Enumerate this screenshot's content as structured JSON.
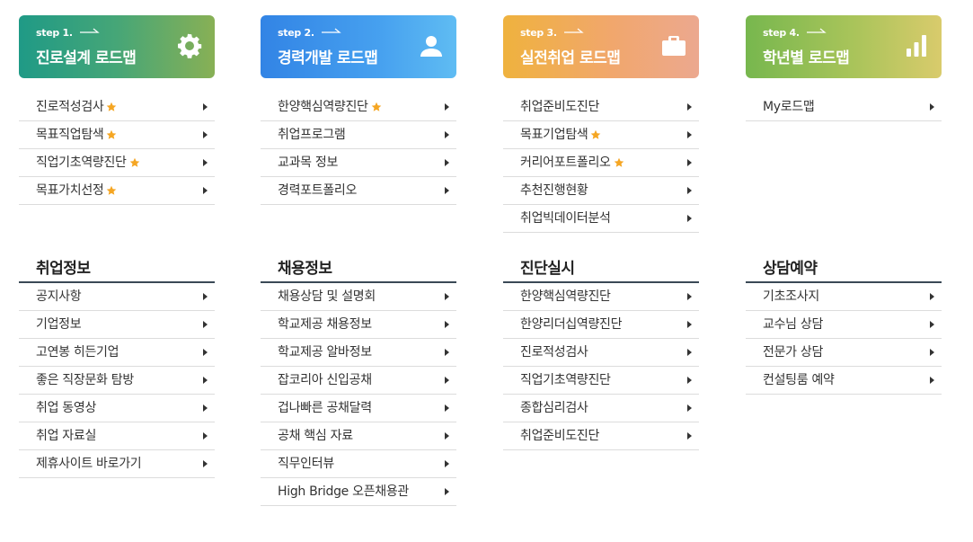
{
  "colors": {
    "step1": "#46a677",
    "step2": "#46a0ef",
    "step3": "#f1a76c",
    "step4": "#a9c45a",
    "star": "#f5a623",
    "section_rule": "#3a4956"
  },
  "roadmaps": [
    {
      "step": "step 1.",
      "title": "진로설계 로드맵",
      "icon": "gear-icon",
      "items": [
        {
          "label": "진로적성검사",
          "star": true
        },
        {
          "label": "목표직업탐색",
          "star": true
        },
        {
          "label": "직업기초역량진단",
          "star": true
        },
        {
          "label": "목표가치선정",
          "star": true
        }
      ]
    },
    {
      "step": "step 2.",
      "title": "경력개발 로드맵",
      "icon": "person-icon",
      "items": [
        {
          "label": "한양핵심역량진단",
          "star": true
        },
        {
          "label": "취업프로그램",
          "star": false
        },
        {
          "label": "교과목 정보",
          "star": false
        },
        {
          "label": "경력포트폴리오",
          "star": false
        }
      ]
    },
    {
      "step": "step 3.",
      "title": "실전취업 로드맵",
      "icon": "briefcase-icon",
      "items": [
        {
          "label": "취업준비도진단",
          "star": false
        },
        {
          "label": "목표기업탐색",
          "star": true
        },
        {
          "label": "커리어포트폴리오",
          "star": true
        },
        {
          "label": "추천진행현황",
          "star": false
        },
        {
          "label": "취업빅데이터분석",
          "star": false
        }
      ]
    },
    {
      "step": "step 4.",
      "title": "학년별 로드맵",
      "icon": "bar-chart-icon",
      "items": [
        {
          "label": "My로드맵",
          "star": false
        }
      ]
    }
  ],
  "sections": [
    {
      "title": "취업정보",
      "items": [
        "공지사항",
        "기업정보",
        "고연봉 히든기업",
        "좋은 직장문화 탐방",
        "취업 동영상",
        "취업 자료실",
        "제휴사이트 바로가기"
      ]
    },
    {
      "title": "채용정보",
      "items": [
        "채용상담 및 설명회",
        "학교제공 채용정보",
        "학교제공 알바정보",
        "잡코리아 신입공채",
        "겁나빠른 공채달력",
        "공채 핵심 자료",
        "직무인터뷰",
        "High Bridge 오픈채용관"
      ]
    },
    {
      "title": "진단실시",
      "items": [
        "한양핵심역량진단",
        "한양리더십역량진단",
        "진로적성검사",
        "직업기초역량진단",
        "종합심리검사",
        "취업준비도진단"
      ]
    },
    {
      "title": "상담예약",
      "items": [
        "기초조사지",
        "교수님 상담",
        "전문가 상담",
        "컨설팅룸 예약"
      ]
    }
  ]
}
